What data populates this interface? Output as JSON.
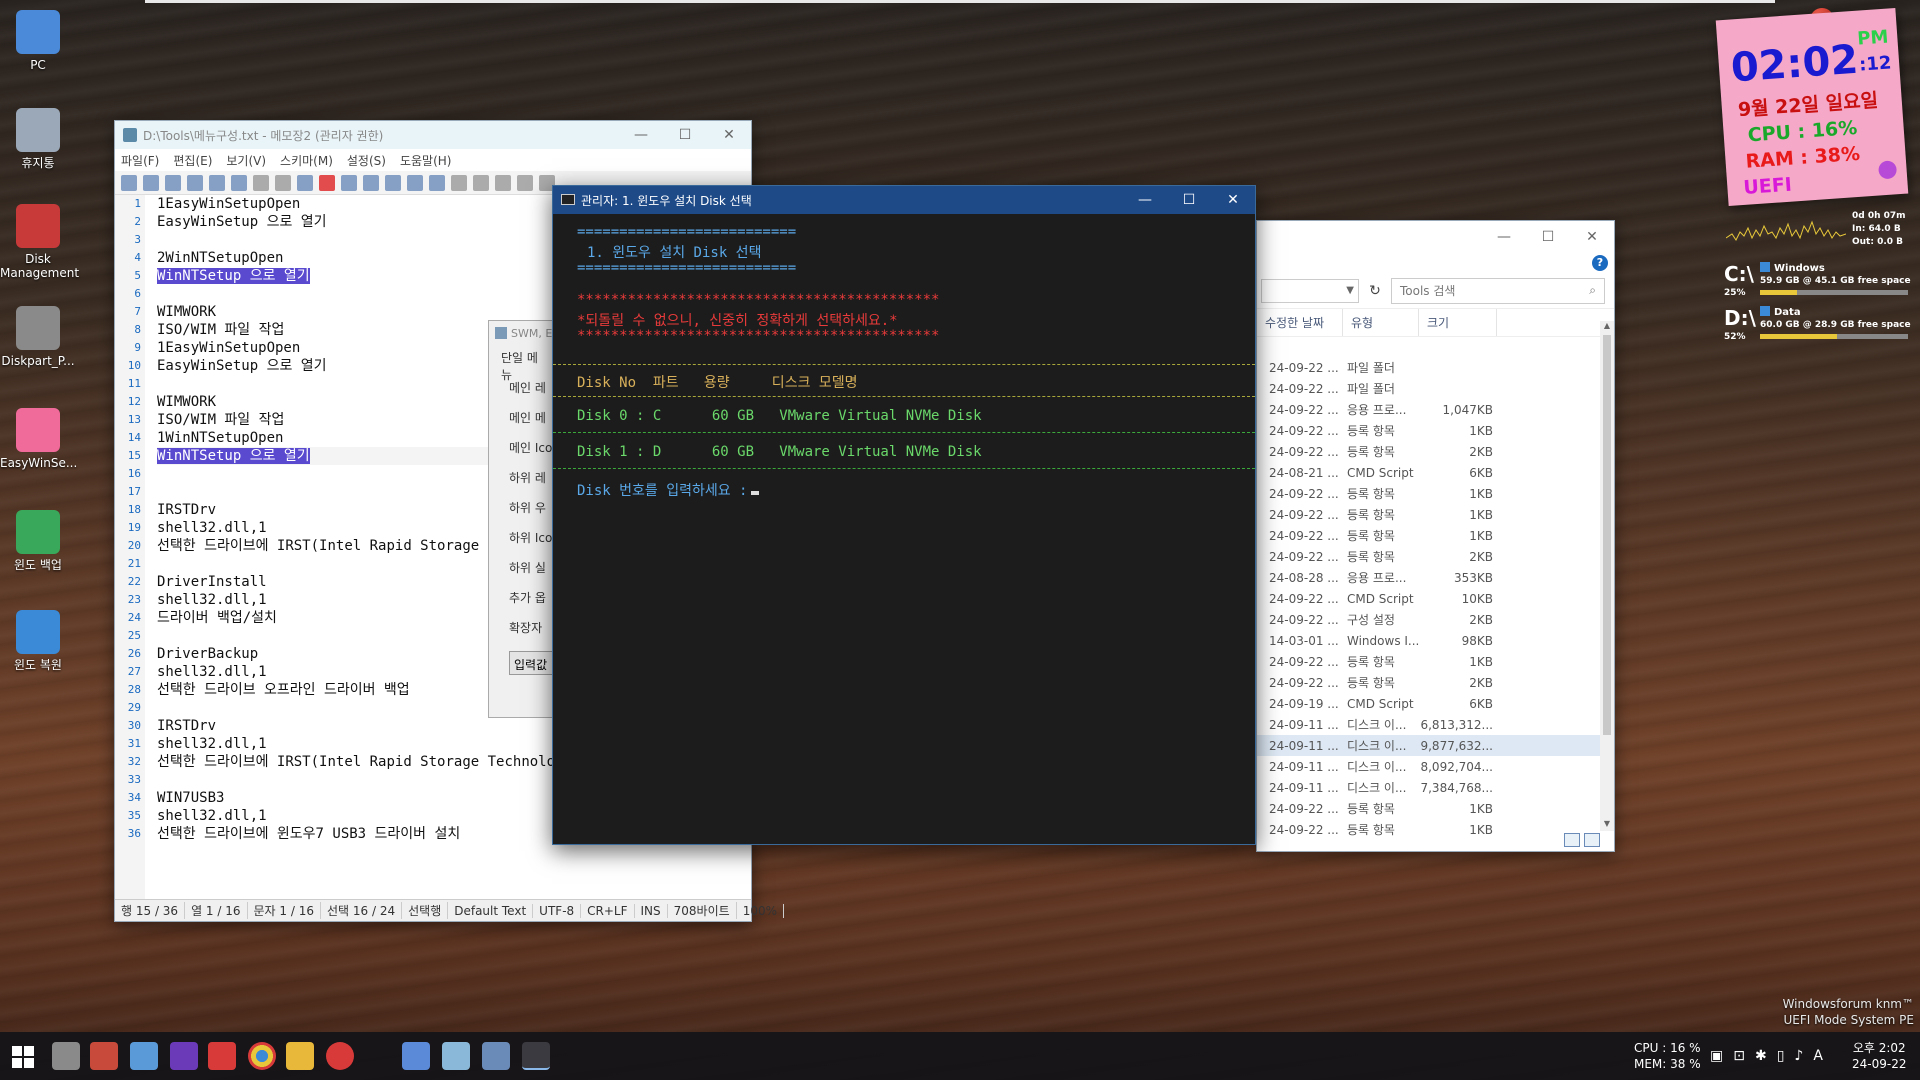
{
  "desktop": {
    "icons": [
      {
        "label": "PC",
        "icon": "computer-icon"
      },
      {
        "label": "휴지통",
        "icon": "recycle-bin-icon"
      },
      {
        "label": "Disk Management",
        "icon": "disk-management-icon"
      },
      {
        "label": "Diskpart_P...",
        "icon": "diskpart-icon"
      },
      {
        "label": "EasyWinSe...",
        "icon": "easywinsetup-icon"
      },
      {
        "label": "윈도 백업",
        "icon": "backup-icon"
      },
      {
        "label": "윈도 복원",
        "icon": "restore-icon"
      }
    ]
  },
  "notepad": {
    "title": "D:\\Tools\\메뉴구성.txt - 메모장2 (관리자 권한)",
    "menu": [
      "파일(F)",
      "편집(E)",
      "보기(V)",
      "스키마(M)",
      "설정(S)",
      "도움말(H)"
    ],
    "lines": [
      "1EasyWinSetupOpen",
      "EasyWinSetup 으로 열기",
      "",
      "2WinNTSetupOpen",
      "WinNTSetup 으로 열기",
      "",
      "WIMWORK",
      "ISO/WIM 파일 작업",
      "1EasyWinSetupOpen",
      "EasyWinSetup 으로 열기",
      "",
      "WIMWORK",
      "ISO/WIM 파일 작업",
      "1WinNTSetupOpen",
      "WinNTSetup 으로 열기",
      "",
      "",
      "IRSTDrv",
      "shell32.dll,1",
      "선택한 드라이브에 IRST(Intel Rapid Storage",
      "",
      "DriverInstall",
      "shell32.dll,1",
      "드라이버 백업/설치",
      "",
      "DriverBackup",
      "shell32.dll,1",
      "선택한 드라이브 오프라인 드라이버 백업",
      "",
      "IRSTDrv",
      "shell32.dll,1",
      "선택한 드라이브에 IRST(Intel Rapid Storage Technolo",
      "",
      "WIN7USB3",
      "shell32.dll,1",
      "선택한 드라이브에 윈도우7 USB3 드라이버 설치"
    ],
    "highlighted_lines": [
      5,
      15
    ],
    "status": [
      "행 15 / 36",
      "열 1 / 16",
      "문자 1 / 16",
      "선택 16 / 24",
      "선택행",
      "Default Text",
      "UTF-8",
      "CR+LF",
      "INS",
      "708바이트",
      "100%"
    ]
  },
  "swm_dialog": {
    "title": "SWM, E",
    "tab": "단일 메뉴",
    "rows": [
      "메인 레",
      "메인 메",
      "메인 Ico",
      "하위 레",
      "하위 우",
      "하위 Ico",
      "하위 실",
      "추가 옵",
      "확장자"
    ],
    "button": "입력값"
  },
  "console": {
    "title": "관리자:  1. 윈도우 설치 Disk 선택",
    "rule": "==========================",
    "heading": "1. 윈도우 설치 Disk 선택",
    "stars": "*******************************************",
    "warning": "*되돌릴 수 없으니, 신중히 정확하게 선택하세요.*",
    "columns": "Disk No  파트   용량     디스크 모델명",
    "disks": [
      "Disk 0 : C      60 GB   VMware Virtual NVMe Disk",
      "Disk 1 : D      60 GB   VMware Virtual NVMe Disk"
    ],
    "prompt": "Disk 번호를 입력하세요 :",
    "colors": {
      "rule": "#5aa8e8",
      "warning": "#e83a3a",
      "header": "#d8b05a",
      "disk": "#6ad86a",
      "prompt": "#5aa8e8"
    }
  },
  "explorer": {
    "search_placeholder": "Tools 검색",
    "columns": [
      "수정한 날짜",
      "유형",
      "크기"
    ],
    "rows": [
      {
        "date": "24-09-22 ...",
        "type": "파일 폴더",
        "size": ""
      },
      {
        "date": "24-09-22 ...",
        "type": "파일 폴더",
        "size": ""
      },
      {
        "date": "24-09-22 ...",
        "type": "응용 프로...",
        "size": "1,047KB"
      },
      {
        "date": "24-09-22 ...",
        "type": "등록 항목",
        "size": "1KB"
      },
      {
        "date": "24-09-22 ...",
        "type": "등록 항목",
        "size": "2KB"
      },
      {
        "date": "24-08-21 ...",
        "type": "CMD Script",
        "size": "6KB"
      },
      {
        "date": "24-09-22 ...",
        "type": "등록 항목",
        "size": "1KB"
      },
      {
        "date": "24-09-22 ...",
        "type": "등록 항목",
        "size": "1KB"
      },
      {
        "date": "24-09-22 ...",
        "type": "등록 항목",
        "size": "1KB"
      },
      {
        "date": "24-09-22 ...",
        "type": "등록 항목",
        "size": "2KB"
      },
      {
        "date": "24-08-28 ...",
        "type": "응용 프로...",
        "size": "353KB"
      },
      {
        "date": "24-09-22 ...",
        "type": "CMD Script",
        "size": "10KB"
      },
      {
        "date": "24-09-22 ...",
        "type": "구성 설정",
        "size": "2KB"
      },
      {
        "date": "14-03-01 ...",
        "type": "Windows I...",
        "size": "98KB"
      },
      {
        "date": "24-09-22 ...",
        "type": "등록 항목",
        "size": "1KB"
      },
      {
        "date": "24-09-22 ...",
        "type": "등록 항목",
        "size": "2KB"
      },
      {
        "date": "24-09-19 ...",
        "type": "CMD Script",
        "size": "6KB"
      },
      {
        "date": "24-09-11 ...",
        "type": "디스크 이...",
        "size": "6,813,312..."
      },
      {
        "date": "24-09-11 ...",
        "type": "디스크 이...",
        "size": "9,877,632..."
      },
      {
        "date": "24-09-11 ...",
        "type": "디스크 이...",
        "size": "8,092,704..."
      },
      {
        "date": "24-09-11 ...",
        "type": "디스크 이...",
        "size": "7,384,768..."
      },
      {
        "date": "24-09-22 ...",
        "type": "등록 항목",
        "size": "1KB"
      },
      {
        "date": "24-09-22 ...",
        "type": "등록 항목",
        "size": "1KB"
      }
    ],
    "selected_row": 18
  },
  "clock": {
    "time": "02:02",
    "seconds": ":12",
    "ampm": "PM",
    "date": "9월 22일 일요일",
    "cpu": "CPU :  16%",
    "ram": "RAM :  38%",
    "mode": "UEFI"
  },
  "network": {
    "uptime": "0d 0h 07m",
    "in": "In: 64.0 B",
    "out": "Out: 0.0 B"
  },
  "drives": [
    {
      "letter": "C:\\",
      "percent": "25%",
      "name": "Windows",
      "info": "59.9 GB @    45.1 GB free space",
      "used": 0.25
    },
    {
      "letter": "D:\\",
      "percent": "52%",
      "name": "Data",
      "info": "60.0 GB @    28.9 GB free space",
      "used": 0.52
    }
  ],
  "watermark": [
    "Windowsforum knm™",
    "UEFI Mode System PE"
  ],
  "taskbar": {
    "cpu": "CPU : 16 %",
    "mem": "MEM: 38 %",
    "time": "오후 2:02",
    "date": "24-09-22",
    "ime": "A"
  }
}
